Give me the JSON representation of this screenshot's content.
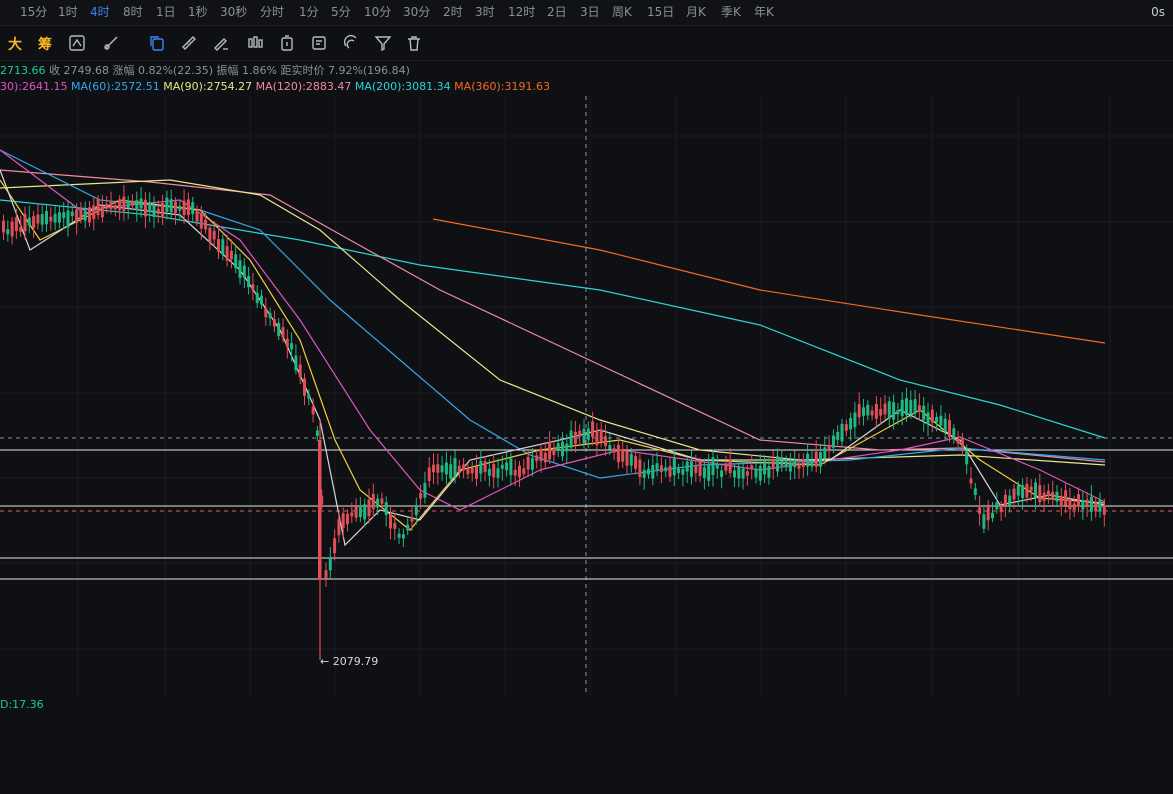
{
  "timeframes": [
    "15分",
    "1时",
    "4时",
    "8时",
    "1日",
    "1秒",
    "30秒",
    "分时",
    "1分",
    "5分",
    "10分",
    "30分",
    "2时",
    "3时",
    "12时",
    "2日",
    "3日",
    "周K",
    "15日",
    "月K",
    "季K",
    "年K"
  ],
  "active_timeframe": "4时",
  "countdown": "0s",
  "toolbar": {
    "label_1": "大",
    "label_2": "筹"
  },
  "info": {
    "open_tail": "2713.66",
    "close": "收 2749.68",
    "change": "涨幅 0.82%(22.35)",
    "amplitude": "振幅 1.86%",
    "distance": "距实时价 7.92%(196.84)"
  },
  "ma": [
    {
      "text": "30):2641.15",
      "color": "#e055c0"
    },
    {
      "text": "MA(60):2572.51",
      "color": "#35a6ea"
    },
    {
      "text": "MA(90):2754.27",
      "color": "#e6e68a"
    },
    {
      "text": "MA(120):2883.47",
      "color": "#f08aa2"
    },
    {
      "text": "MA(200):3081.34",
      "color": "#2ad4d4"
    },
    {
      "text": "MA(360):3191.63",
      "color": "#f26a1f"
    }
  ],
  "low_marker": "← 2079.79",
  "macd_label": "D:17.36",
  "icons": [
    "copy-icon",
    "ruler-icon",
    "pencil-line-icon",
    "candles-icon",
    "timer-icon",
    "note-icon",
    "magnet-icon",
    "filter-icon",
    "trash-icon"
  ]
}
